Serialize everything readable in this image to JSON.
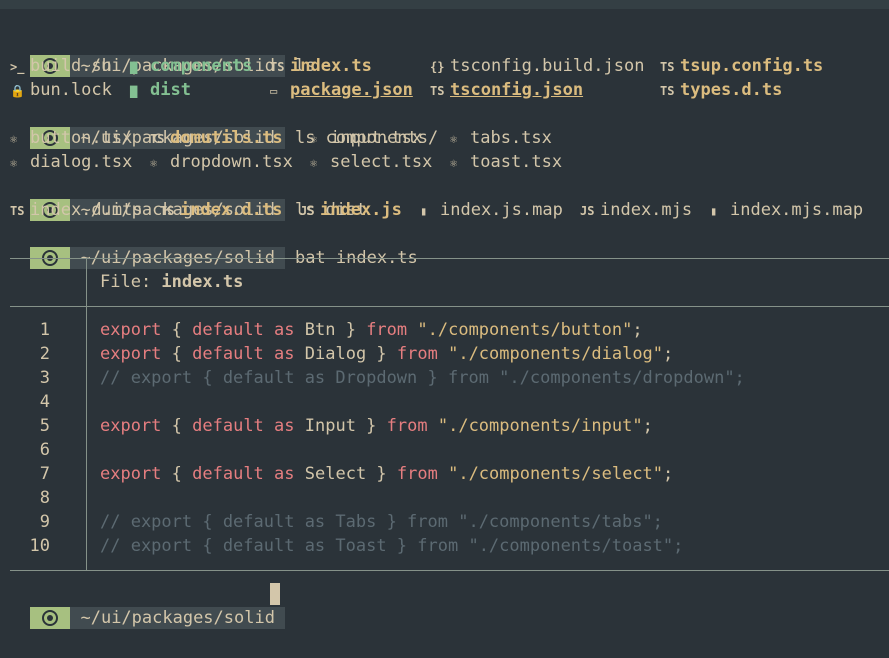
{
  "prompt_path": "~/ui/packages/solid",
  "commands": [
    "ls",
    "ls components/",
    "ls dist",
    "bat index.ts"
  ],
  "ls_root": [
    {
      "icon": "terminal-icon",
      "glyph": ">_",
      "name": "build.sh",
      "style": "plain"
    },
    {
      "icon": "folder-icon",
      "glyph": "▇",
      "name": "components",
      "style": "dir"
    },
    {
      "icon": "typescript-icon",
      "glyph": "TS",
      "name": "index.ts",
      "style": "bold"
    },
    {
      "icon": "json-icon",
      "glyph": "{}",
      "name": "tsconfig.build.json",
      "style": "plain"
    },
    {
      "icon": "typescript-icon",
      "glyph": "TS",
      "name": "tsup.config.ts",
      "style": "bold"
    },
    {
      "icon": "lock-icon",
      "glyph": "🔒",
      "name": "bun.lock",
      "style": "plain"
    },
    {
      "icon": "folder-icon",
      "glyph": "▇",
      "name": "dist",
      "style": "dir"
    },
    {
      "icon": "package-icon",
      "glyph": "▭",
      "name": "package.json",
      "style": "under"
    },
    {
      "icon": "typescript-icon",
      "glyph": "TS",
      "name": "tsconfig.json",
      "style": "under"
    },
    {
      "icon": "typescript-icon",
      "glyph": "TS",
      "name": "types.d.ts",
      "style": "bold"
    }
  ],
  "ls_components": [
    {
      "icon": "react-icon",
      "glyph": "⚛",
      "name": "button.tsx",
      "style": "plain"
    },
    {
      "icon": "typescript-icon",
      "glyph": "TS",
      "name": "domutils.ts",
      "style": "bold"
    },
    {
      "icon": "react-icon",
      "glyph": "⚛",
      "name": "input.tsx",
      "style": "plain"
    },
    {
      "icon": "react-icon",
      "glyph": "⚛",
      "name": "tabs.tsx",
      "style": "plain"
    },
    {
      "icon": "react-icon",
      "glyph": "⚛",
      "name": "dialog.tsx",
      "style": "plain"
    },
    {
      "icon": "react-icon",
      "glyph": "⚛",
      "name": "dropdown.tsx",
      "style": "plain"
    },
    {
      "icon": "react-icon",
      "glyph": "⚛",
      "name": "select.tsx",
      "style": "plain"
    },
    {
      "icon": "react-icon",
      "glyph": "⚛",
      "name": "toast.tsx",
      "style": "plain"
    }
  ],
  "ls_dist": [
    {
      "icon": "typescript-icon",
      "glyph": "TS",
      "name": "index.d.mts",
      "style": "plain"
    },
    {
      "icon": "typescript-icon",
      "glyph": "TS",
      "name": "index.d.ts",
      "style": "bold"
    },
    {
      "icon": "javascript-icon",
      "glyph": "JS",
      "name": "index.js",
      "style": "bold"
    },
    {
      "icon": "file-icon",
      "glyph": "▮",
      "name": "index.js.map",
      "style": "plain"
    },
    {
      "icon": "javascript-icon",
      "glyph": "JS",
      "name": "index.mjs",
      "style": "plain"
    },
    {
      "icon": "file-icon",
      "glyph": "▮",
      "name": "index.mjs.map",
      "style": "plain"
    }
  ],
  "bat": {
    "file_label": "File: ",
    "file_name": "index.ts",
    "lines": [
      {
        "n": "1",
        "parts": [
          [
            "kw",
            "export"
          ],
          [
            "p",
            " { "
          ],
          [
            "kw",
            "default"
          ],
          [
            "p",
            " "
          ],
          [
            "kw",
            "as"
          ],
          [
            "p",
            " Btn } "
          ],
          [
            "kw",
            "from"
          ],
          [
            "p",
            " "
          ],
          [
            "str",
            "\"./components/button\""
          ],
          [
            "p",
            ";"
          ]
        ]
      },
      {
        "n": "2",
        "parts": [
          [
            "kw",
            "export"
          ],
          [
            "p",
            " { "
          ],
          [
            "kw",
            "default"
          ],
          [
            "p",
            " "
          ],
          [
            "kw",
            "as"
          ],
          [
            "p",
            " Dialog } "
          ],
          [
            "kw",
            "from"
          ],
          [
            "p",
            " "
          ],
          [
            "str",
            "\"./components/dialog\""
          ],
          [
            "p",
            ";"
          ]
        ]
      },
      {
        "n": "3",
        "parts": [
          [
            "cm",
            "// export { default as Dropdown } from \"./components/dropdown\";"
          ]
        ]
      },
      {
        "n": "4",
        "parts": []
      },
      {
        "n": "5",
        "parts": [
          [
            "kw",
            "export"
          ],
          [
            "p",
            " { "
          ],
          [
            "kw",
            "default"
          ],
          [
            "p",
            " "
          ],
          [
            "kw",
            "as"
          ],
          [
            "p",
            " Input } "
          ],
          [
            "kw",
            "from"
          ],
          [
            "p",
            " "
          ],
          [
            "str",
            "\"./components/input\""
          ],
          [
            "p",
            ";"
          ]
        ]
      },
      {
        "n": "6",
        "parts": []
      },
      {
        "n": "7",
        "parts": [
          [
            "kw",
            "export"
          ],
          [
            "p",
            " { "
          ],
          [
            "kw",
            "default"
          ],
          [
            "p",
            " "
          ],
          [
            "kw",
            "as"
          ],
          [
            "p",
            " Select } "
          ],
          [
            "kw",
            "from"
          ],
          [
            "p",
            " "
          ],
          [
            "str",
            "\"./components/select\""
          ],
          [
            "p",
            ";"
          ]
        ]
      },
      {
        "n": "8",
        "parts": []
      },
      {
        "n": "9",
        "parts": [
          [
            "cm",
            "// export { default as Tabs } from \"./components/tabs\";"
          ]
        ]
      },
      {
        "n": "10",
        "parts": [
          [
            "cm",
            "// export { default as Toast } from \"./components/toast\";"
          ]
        ]
      }
    ]
  }
}
